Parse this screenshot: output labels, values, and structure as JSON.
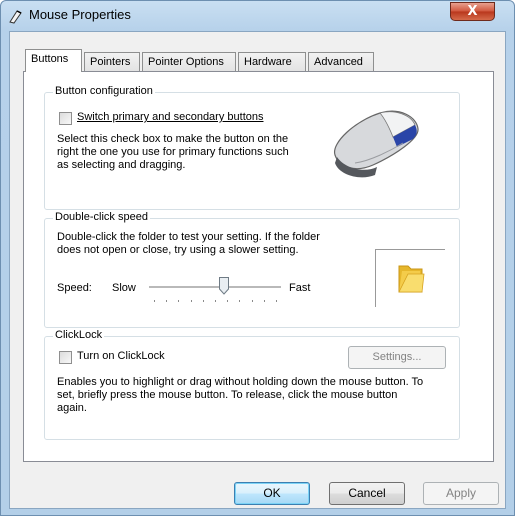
{
  "window": {
    "title": "Mouse Properties",
    "close_glyph": "X"
  },
  "tabs": [
    "Buttons",
    "Pointers",
    "Pointer Options",
    "Hardware",
    "Advanced"
  ],
  "button_config": {
    "group_title": "Button configuration",
    "checkbox_label": "Switch primary and secondary buttons",
    "checked": false,
    "description": "Select this check box to make the button on the right the one you use for primary functions such as selecting and dragging."
  },
  "double_click": {
    "group_title": "Double-click speed",
    "description": "Double-click the folder to test your setting. If the folder does not open or close, try using a slower setting.",
    "speed_label": "Speed:",
    "slow_label": "Slow",
    "fast_label": "Fast",
    "slider_fraction": 0.57
  },
  "clicklock": {
    "group_title": "ClickLock",
    "checkbox_label": "Turn on ClickLock",
    "checked": false,
    "settings_label": "Settings...",
    "description": "Enables you to highlight or drag without holding down the mouse button. To set, briefly press the mouse button. To release, click the mouse button again."
  },
  "footer": {
    "ok": "OK",
    "cancel": "Cancel",
    "apply": "Apply"
  },
  "icons": {
    "title": "mouse-pointer-icon",
    "mouse": "mouse-icon",
    "folder": "folder-icon"
  }
}
